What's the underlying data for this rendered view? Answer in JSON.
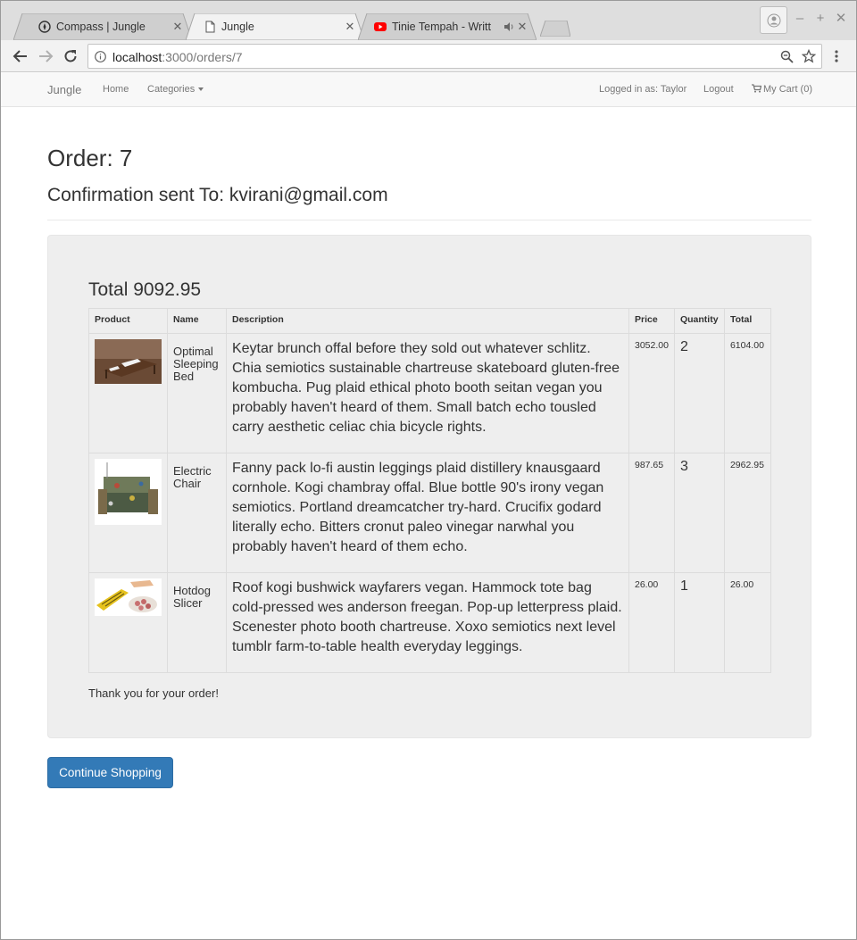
{
  "browser": {
    "tabs": [
      {
        "title": "Compass | Jungle",
        "icon": "compass-icon"
      },
      {
        "title": "Jungle",
        "icon": "page-icon",
        "active": true
      },
      {
        "title": "Tinie Tempah - Writt",
        "icon": "youtube-icon",
        "audio": true
      }
    ],
    "url_host": "localhost",
    "url_path": ":3000/orders/7"
  },
  "navbar": {
    "brand": "Jungle",
    "home": "Home",
    "categories": "Categories",
    "logged_in": "Logged in as: Taylor",
    "logout": "Logout",
    "cart": "My Cart (0)"
  },
  "order": {
    "title": "Order: 7",
    "confirmation": "Confirmation sent To: kvirani@gmail.com",
    "total": "Total 9092.95",
    "columns": [
      "Product",
      "Name",
      "Description",
      "Price",
      "Quantity",
      "Total"
    ],
    "items": [
      {
        "name": "Optimal Sleeping Bed",
        "description": "Keytar brunch offal before they sold out whatever schlitz. Chia semiotics sustainable chartreuse skateboard gluten-free kombucha. Pug plaid ethical photo booth seitan vegan you probably haven't heard of them. Small batch echo tousled carry aesthetic celiac chia bicycle rights.",
        "price": "3052.00",
        "quantity": "2",
        "total": "6104.00"
      },
      {
        "name": "Electric Chair",
        "description": "Fanny pack lo-fi austin leggings plaid distillery knausgaard cornhole. Kogi chambray offal. Blue bottle 90's irony vegan semiotics. Portland dreamcatcher try-hard. Crucifix godard literally echo. Bitters cronut paleo vinegar narwhal you probably haven't heard of them echo.",
        "price": "987.65",
        "quantity": "3",
        "total": "2962.95"
      },
      {
        "name": "Hotdog Slicer",
        "description": "Roof kogi bushwick wayfarers vegan. Hammock tote bag cold-pressed wes anderson freegan. Pop-up letterpress plaid. Scenester photo booth chartreuse. Xoxo semiotics next level tumblr farm-to-table health everyday leggings.",
        "price": "26.00",
        "quantity": "1",
        "total": "26.00"
      }
    ],
    "thanks": "Thank you for your order!",
    "continue": "Continue Shopping"
  },
  "colors": {
    "primary_button": "#337ab7",
    "panel_bg": "#eeeeee",
    "youtube_red": "#ff0000"
  }
}
